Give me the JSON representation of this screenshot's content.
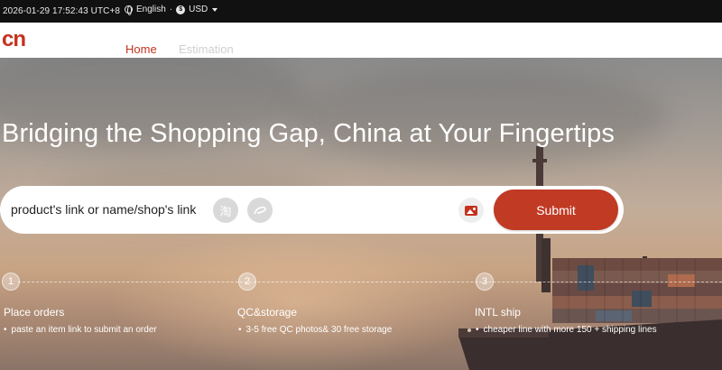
{
  "topbar": {
    "datetime": "2026-01-29 17:52:43 UTC+8",
    "language": "English",
    "separator": "·",
    "currency_symbol": "$",
    "currency": "USD"
  },
  "nav": {
    "logo": "cn",
    "home": "Home",
    "estimation": "Estimation"
  },
  "hero": {
    "headline": "Bridging the Shopping Gap, China at Your Fingertips",
    "search": {
      "placeholder": "product's link or name/shop's link",
      "taobao_glyph": "淘",
      "submit": "Submit"
    },
    "steps": [
      {
        "num": "1",
        "title": "Place orders",
        "desc": "paste an item link to submit an order"
      },
      {
        "num": "2",
        "title": "QC&storage",
        "desc": "3-5 free QC photos& 30 free storage"
      },
      {
        "num": "3",
        "title": "INTL ship",
        "desc": "cheaper line with more 150 + shipping lines"
      }
    ]
  },
  "colors": {
    "brand": "#c4321f",
    "submit": "#c13a24",
    "topbar": "#111111"
  }
}
